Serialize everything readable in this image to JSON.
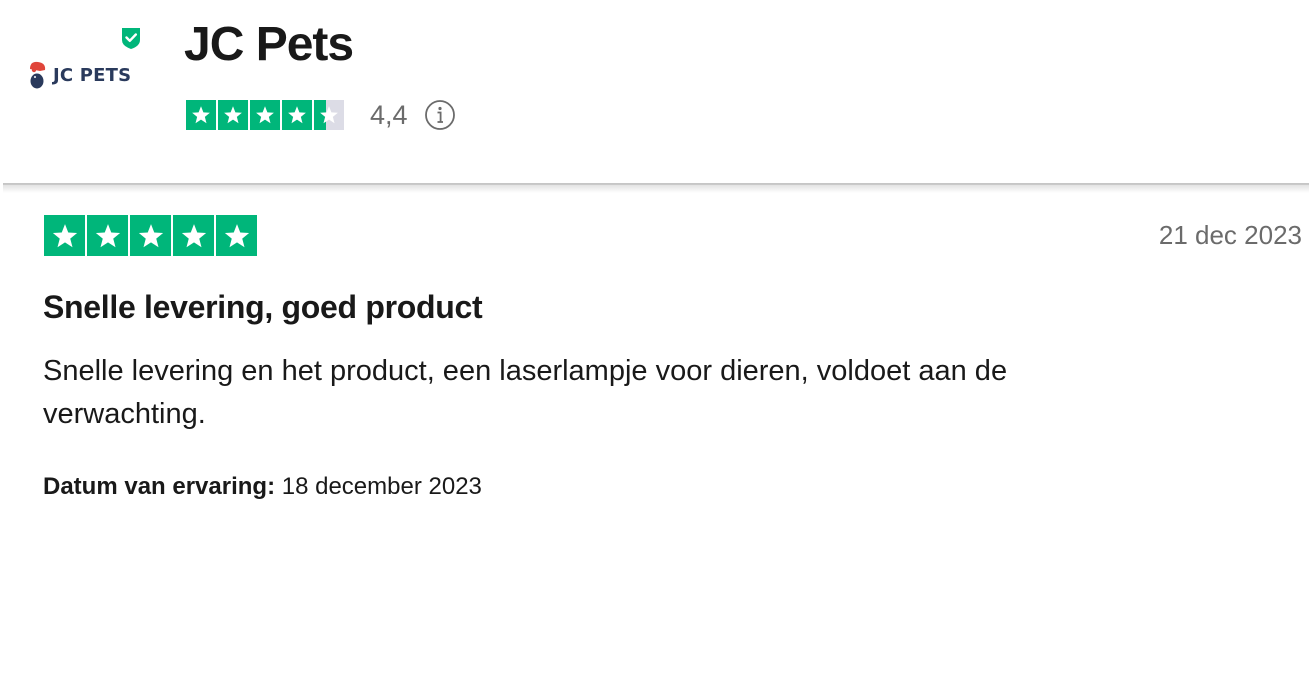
{
  "company": {
    "name": "JC Pets",
    "logo_text": "JC PETS",
    "trust_score": "4,4",
    "rating_stars": 4.4
  },
  "review": {
    "stars": 5,
    "date": "21 dec 2023",
    "title": "Snelle levering, goed product",
    "body": "Snelle levering en het product, een laserlampje voor dieren, voldoet aan de verwachting.",
    "experience_label": "Datum van ervaring:",
    "experience_date": "18 december 2023"
  },
  "colors": {
    "star_green": "#00b67a",
    "star_empty": "#dcdce6",
    "text_muted": "#6b6b6b",
    "logo_navy": "#2a3a5c",
    "logo_red": "#e0453a"
  },
  "icons": {
    "verified": "verified-shield-icon",
    "info": "info-circle-icon",
    "star": "star-icon"
  }
}
